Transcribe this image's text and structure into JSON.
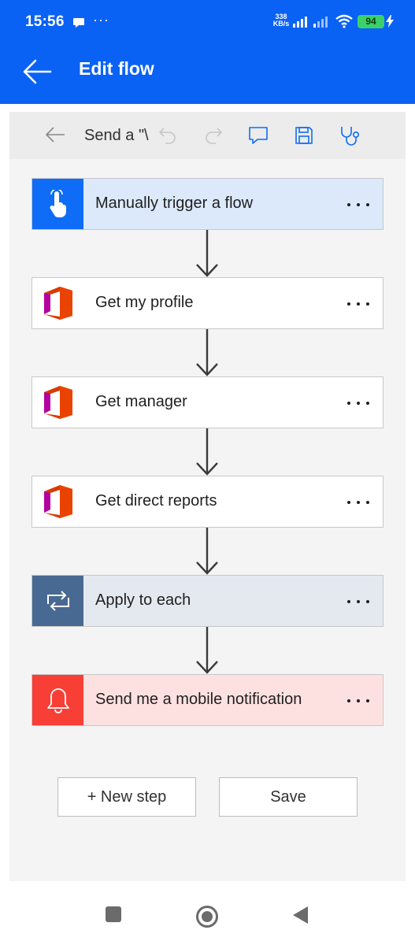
{
  "status_bar": {
    "time": "15:56",
    "more": "···",
    "net_speed_value": "338",
    "net_speed_unit": "KB/s",
    "battery": "94"
  },
  "app_bar": {
    "title": "Edit flow"
  },
  "toolbar": {
    "flow_name": "Send a \"\\"
  },
  "steps": [
    {
      "label": "Manually trigger a flow",
      "icon": "touch-trigger-icon",
      "bg": "#dbe9fb",
      "icon_bg": "#0f6cf6"
    },
    {
      "label": "Get my profile",
      "icon": "office-365-icon",
      "bg": "#ffffff",
      "icon_bg": "#ffffff"
    },
    {
      "label": "Get manager",
      "icon": "office-365-icon",
      "bg": "#ffffff",
      "icon_bg": "#ffffff"
    },
    {
      "label": "Get direct reports",
      "icon": "office-365-icon",
      "bg": "#ffffff",
      "icon_bg": "#ffffff"
    },
    {
      "label": "Apply to each",
      "icon": "loop-icon",
      "bg": "#e4e9f0",
      "icon_bg": "#486991"
    },
    {
      "label": "Send me a mobile notification",
      "icon": "bell-icon",
      "bg": "#fde1e0",
      "icon_bg": "#f73f36"
    }
  ],
  "actions": {
    "new_step": "+ New step",
    "save": "Save"
  },
  "colors": {
    "app_bar": "#0a62f5",
    "accent": "#0f6cf6"
  }
}
